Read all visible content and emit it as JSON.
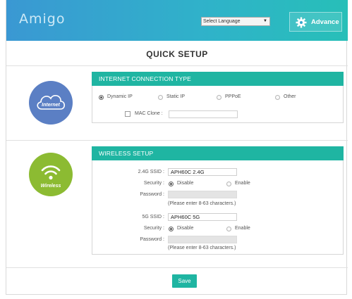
{
  "header": {
    "logo_text": "Amigo",
    "language_select": {
      "selected": "Select Language"
    },
    "advance_label": "Advance"
  },
  "page_title": "QUICK SETUP",
  "internet": {
    "badge_label": "Internet",
    "heading": "INTERNET CONNECTION TYPE",
    "options": [
      {
        "label": "Dynamic IP",
        "selected": true
      },
      {
        "label": "Static IP",
        "selected": false
      },
      {
        "label": "PPPoE",
        "selected": false
      },
      {
        "label": "Other",
        "selected": false
      }
    ],
    "mac_clone_label": "MAC Clone :",
    "mac_clone_value": ""
  },
  "wireless": {
    "badge_label": "Wireless",
    "heading": "WIRELESS SETUP",
    "band_24": {
      "ssid_label": "2.4G SSID :",
      "ssid_value": "APH60C 2.4G",
      "security_label": "Security :",
      "disable_label": "Disable",
      "enable_label": "Enable",
      "password_label": "Password :",
      "password_value": "",
      "hint": "(Please enter 8-63 characters.)"
    },
    "band_5": {
      "ssid_label": "5G SSID :",
      "ssid_value": "APH60C 5G",
      "security_label": "Security :",
      "disable_label": "Disable",
      "enable_label": "Enable",
      "password_label": "Password :",
      "password_value": "",
      "hint": "(Please enter 8-63 characters.)"
    }
  },
  "save_label": "Save",
  "colors": {
    "accent": "#1fb5a2",
    "header_start": "#3a98d3",
    "header_end": "#27bfb8",
    "internet_badge": "#5b7fc4",
    "wireless_badge": "#8cbb32"
  }
}
